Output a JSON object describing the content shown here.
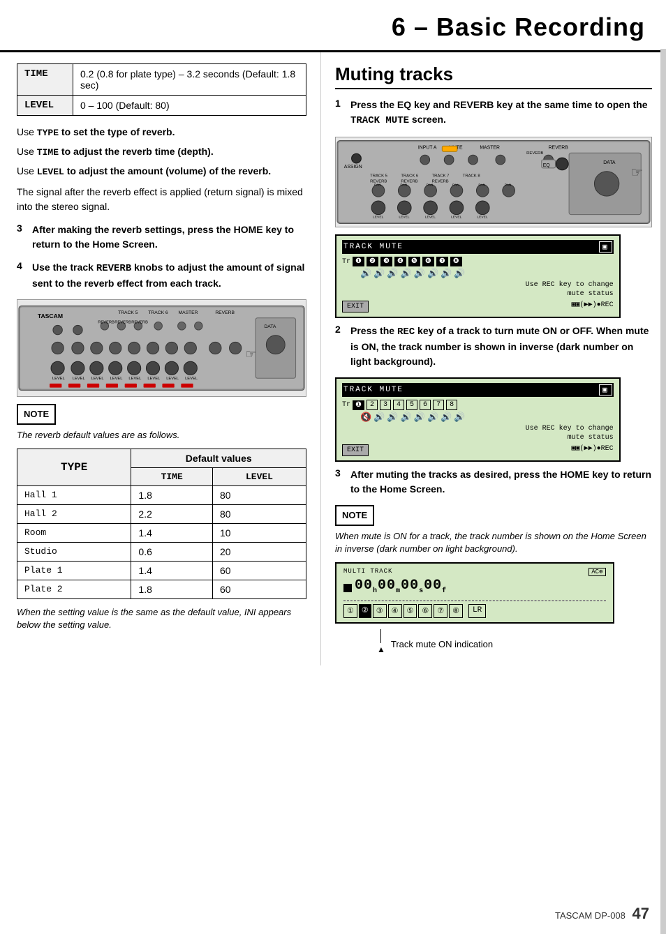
{
  "header": {
    "title": "6 – Basic Recording"
  },
  "left": {
    "top_table": [
      {
        "label": "TIME",
        "value": "0.2 (0.8 for plate type) – 3.2 seconds (Default: 1.8 sec)"
      },
      {
        "label": "LEVEL",
        "value": "0 – 100 (Default: 80)"
      }
    ],
    "use_lines": [
      {
        "prefix": "Use ",
        "code": "TYPE",
        "suffix": " to set the type of reverb."
      },
      {
        "prefix": "Use ",
        "code": "TIME",
        "suffix": " to adjust the reverb time (depth)."
      },
      {
        "prefix": "Use ",
        "code": "LEVEL",
        "suffix": " to adjust the amount (volume) of the reverb."
      }
    ],
    "signal_text": "The signal after the reverb effect is applied (return signal) is mixed into the stereo signal.",
    "step3": {
      "num": "3",
      "text": "After making the reverb settings, press the HOME key to return to the Home Screen."
    },
    "step4": {
      "num": "4",
      "text": "Use the track REVERB knobs to adjust the amount of signal sent to the reverb effect from each track."
    },
    "note_label": "NOTE",
    "note_text": "The reverb default values are as follows.",
    "default_table": {
      "col1_header": "TYPE",
      "col2_header": "Default values",
      "sub_headers": [
        "TIME",
        "LEVEL"
      ],
      "rows": [
        {
          "type": "Hall 1",
          "time": "1.8",
          "level": "80"
        },
        {
          "type": "Hall 2",
          "time": "2.2",
          "level": "80"
        },
        {
          "type": "Room",
          "time": "1.4",
          "level": "10"
        },
        {
          "type": "Studio",
          "time": "0.6",
          "level": "20"
        },
        {
          "type": "Plate 1",
          "time": "1.4",
          "level": "60"
        },
        {
          "type": "Plate 2",
          "time": "1.8",
          "level": "60"
        }
      ]
    },
    "bottom_italic": "When the setting value is the same as the default value, INI appears below the setting value."
  },
  "right": {
    "section_title": "Muting tracks",
    "step1": {
      "num": "1",
      "text": "Press the EQ key and REVERB key at the same time to open the TRACK MUTE screen."
    },
    "step2": {
      "num": "2",
      "text": "Press the REC key of a track to turn mute ON or OFF. When mute is ON, the track number is shown in inverse (dark number on light background)."
    },
    "step3": {
      "num": "3",
      "text": "After muting the tracks as desired, press the HOME key to return to the Home Screen."
    },
    "note_label": "NOTE",
    "note_text": "When mute is ON for a track, the track number is shown on the Home Screen in inverse (dark number on light background).",
    "track_mute_label": "TRACK MUTE",
    "use_rec_text": "Use REC key to change\nmute status",
    "track_mute_on_label": "Track mute ON indication",
    "exit_label": "EXIT",
    "home_screen_label": "MULTI TRACK",
    "home_time": "00h00m00s00f",
    "tracks": [
      "①",
      "②",
      "③",
      "④",
      "⑤",
      "⑥",
      "⑦",
      "⑧",
      "LR"
    ]
  },
  "footer": {
    "brand": "TASCAM  DP-008",
    "page_num": "47"
  }
}
